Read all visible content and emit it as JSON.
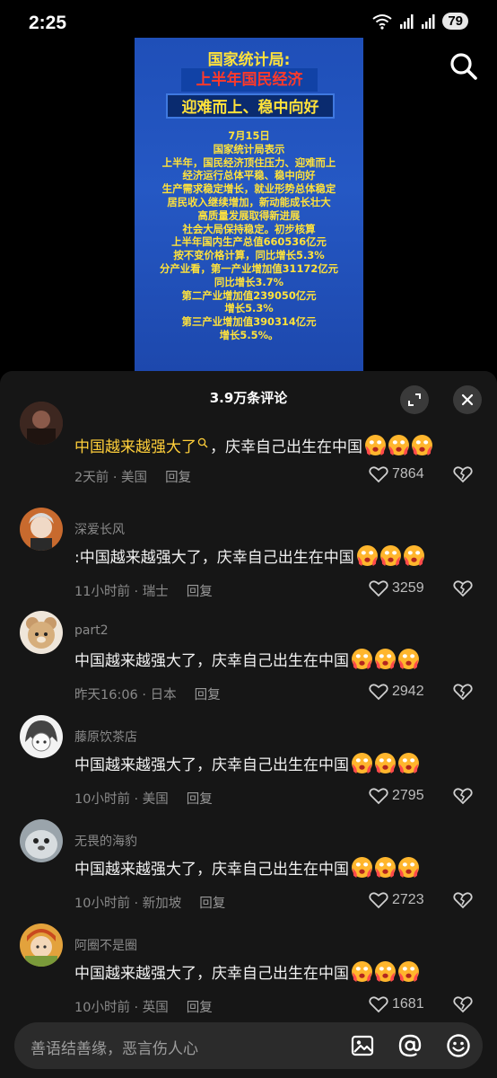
{
  "status_bar": {
    "time": "2:25",
    "battery": "79"
  },
  "video": {
    "title_line1": "国家统计局:",
    "title_line2": "上半年国民经济",
    "title_line3": "迎难而上、稳中向好",
    "body_lines": [
      "7月15日",
      "国家统计局表示",
      "上半年，国民经济顶住压力、迎难而上",
      "经济运行总体平稳、稳中向好",
      "生产需求稳定增长，就业形势总体稳定",
      "居民收入继续增加，新动能成长壮大",
      "高质量发展取得新进展",
      "社会大局保持稳定。初步核算",
      "上半年国内生产总值660536亿元",
      "按不变价格计算，同比增长5.3%",
      "分产业看，第一产业增加值31172亿元",
      "同比增长3.7%",
      "第二产业增加值239050亿元",
      "增长5.3%",
      "第三产业增加值390314亿元",
      "增长5.5%。"
    ]
  },
  "comments_panel": {
    "title": "3.9万条评论",
    "comments": [
      {
        "username": "",
        "text_highlight": "中国越来越强大了",
        "text": "，庆幸自己出生在中国",
        "time_location": "2天前 · 美国",
        "reply": "回复",
        "likes": "7864"
      },
      {
        "username": "深爱长风",
        "text_highlight": "",
        "text": ":中国越来越强大了，庆幸自己出生在中国",
        "time_location": "11小时前 · 瑞士",
        "reply": "回复",
        "likes": "3259"
      },
      {
        "username": "part2",
        "text_highlight": "",
        "text": "中国越来越强大了，庆幸自己出生在中国",
        "time_location": "昨天16:06 · 日本",
        "reply": "回复",
        "likes": "2942"
      },
      {
        "username": "藤原饮茶店",
        "text_highlight": "",
        "text": "中国越来越强大了，庆幸自己出生在中国",
        "time_location": "10小时前 · 美国",
        "reply": "回复",
        "likes": "2795"
      },
      {
        "username": "无畏的海豹",
        "text_highlight": "",
        "text": "中国越来越强大了，庆幸自己出生在中国",
        "time_location": "10小时前 · 新加坡",
        "reply": "回复",
        "likes": "2723"
      },
      {
        "username": "阿圈不是圈",
        "text_highlight": "",
        "text": "中国越来越强大了，庆幸自己出生在中国",
        "time_location": "10小时前 · 英国",
        "reply": "回复",
        "likes": "1681"
      }
    ]
  },
  "input_bar": {
    "placeholder": "善语结善缘，恶言伤人心"
  },
  "colors": {
    "sheet_bg": "#161616",
    "video_blue": "#2558c4",
    "video_text_yellow": "#ffe23b",
    "highlight_yellow": "#ffcf3a"
  }
}
